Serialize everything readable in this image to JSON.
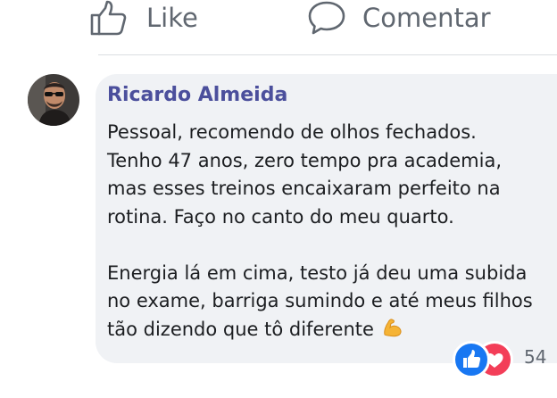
{
  "actions": {
    "like_label": "Like",
    "comment_label": "Comentar"
  },
  "comment": {
    "author": "Ricardo Almeida",
    "paragraph1": [
      "Pessoal, recomendo de olhos fechados.",
      "Tenho 47 anos, zero tempo pra academia,",
      "mas esses treinos encaixaram perfeito na",
      "rotina. Faço no canto do meu quarto."
    ],
    "paragraph2": [
      "Energia lá em cima, testo já deu uma subida",
      "no exame, barriga sumindo e até meus filhos",
      "tão dizendo que tô diferente"
    ],
    "emoji": "flexed-biceps-emoji",
    "reactions": {
      "icons": [
        "like-icon",
        "love-icon"
      ],
      "count": "54"
    }
  },
  "colors": {
    "author": "#4b4f9c",
    "bubble": "#f0f2f5",
    "like_blue": "#1877f2",
    "love_red": "#f33e58",
    "muted": "#606770"
  }
}
